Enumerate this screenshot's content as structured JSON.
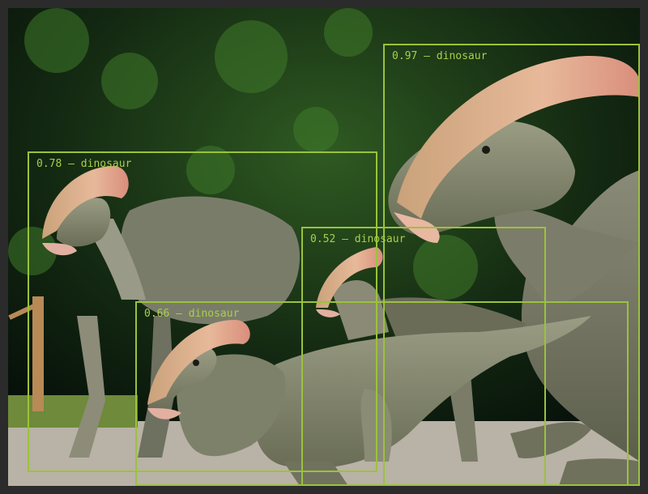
{
  "image": {
    "subject": "dinosaur",
    "box_color": "#9bc23c",
    "label_color": "#a9cf4a"
  },
  "detections": [
    {
      "label": "0.97 – dinosaur",
      "score": 0.97,
      "class": "dinosaur"
    },
    {
      "label": "0.78 – dinosaur",
      "score": 0.78,
      "class": "dinosaur"
    },
    {
      "label": "0.52 – dinosaur",
      "score": 0.52,
      "class": "dinosaur"
    },
    {
      "label": "0.66 – dinosaur",
      "score": 0.66,
      "class": "dinosaur"
    }
  ]
}
